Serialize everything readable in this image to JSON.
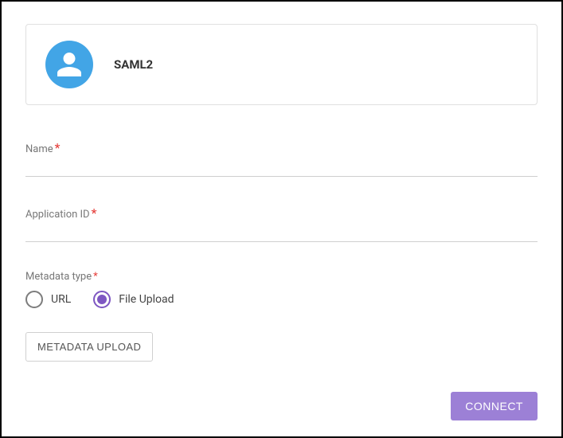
{
  "header": {
    "title": "SAML2",
    "icon": "person-icon"
  },
  "fields": {
    "name": {
      "label": "Name",
      "required_mark": "*",
      "value": ""
    },
    "application_id": {
      "label": "Application ID",
      "required_mark": "*",
      "value": ""
    },
    "metadata_type": {
      "label": "Metadata type",
      "required_mark": "*",
      "options": [
        {
          "label": "URL",
          "selected": false
        },
        {
          "label": "File Upload",
          "selected": true
        }
      ]
    }
  },
  "buttons": {
    "metadata_upload": "Metadata Upload",
    "connect": "Connect"
  },
  "colors": {
    "accent_blue": "#42a5e6",
    "accent_purple": "#7e57c2",
    "button_purple": "#9c80d6",
    "required_red": "#e53935"
  }
}
